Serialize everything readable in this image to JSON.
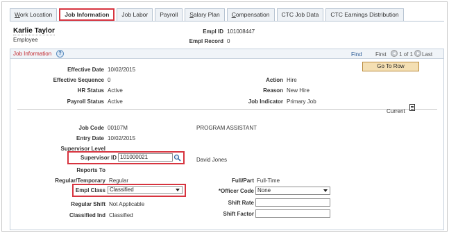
{
  "tabs": [
    {
      "label": "Work Location",
      "ul": "W",
      "rest": "ork Location",
      "active": false
    },
    {
      "label": "Job Information",
      "ul": "",
      "rest": "Job Information",
      "active": true
    },
    {
      "label": "Job Labor",
      "ul": "",
      "rest": "Job Labor",
      "active": false
    },
    {
      "label": "Payroll",
      "ul": "",
      "rest": "Payroll",
      "active": false
    },
    {
      "label": "Salary Plan",
      "ul": "S",
      "rest": "alary Plan",
      "active": false
    },
    {
      "label": "Compensation",
      "ul": "C",
      "rest": "ompensation",
      "active": false
    },
    {
      "label": "CTC Job Data",
      "ul": "",
      "rest": "CTC Job Data",
      "active": false
    },
    {
      "label": "CTC Earnings Distribution",
      "ul": "",
      "rest": "CTC Earnings Distribution",
      "active": false
    }
  ],
  "header": {
    "name": "Karlie Taylor",
    "role": "Employee",
    "empl_id_label": "Empl ID",
    "empl_id": "101008447",
    "empl_record_label": "Empl Record",
    "empl_record": "0"
  },
  "section": {
    "title": "Job Information",
    "help_icon": "?",
    "find": "Find",
    "first": "First",
    "count": "1 of 1",
    "last": "Last",
    "goto_row": "Go To Row",
    "current": "Current"
  },
  "fields": {
    "effective_date": {
      "label": "Effective Date",
      "value": "10/02/2015"
    },
    "effective_sequence": {
      "label": "Effective Sequence",
      "value": "0"
    },
    "hr_status": {
      "label": "HR Status",
      "value": "Active"
    },
    "payroll_status": {
      "label": "Payroll Status",
      "value": "Active"
    },
    "action": {
      "label": "Action",
      "value": "Hire"
    },
    "reason": {
      "label": "Reason",
      "value": "New Hire"
    },
    "job_indicator": {
      "label": "Job Indicator",
      "value": "Primary Job"
    },
    "job_code": {
      "label": "Job Code",
      "value": "00107M",
      "desc": "PROGRAM ASSISTANT"
    },
    "entry_date": {
      "label": "Entry Date",
      "value": "10/02/2015"
    },
    "supervisor_level": {
      "label": "Supervisor Level"
    },
    "supervisor_id": {
      "label": "Supervisor ID",
      "value": "101000021",
      "desc": "David Jones"
    },
    "reports_to": {
      "label": "Reports To"
    },
    "regular_temporary": {
      "label": "Regular/Temporary",
      "value": "Regular"
    },
    "full_part": {
      "label": "Full/Part",
      "value": "Full-Time"
    },
    "empl_class": {
      "label": "Empl Class",
      "value": "Classified"
    },
    "officer_code": {
      "label": "*Officer Code",
      "value": "None"
    },
    "regular_shift": {
      "label": "Regular Shift",
      "value": "Not Applicable"
    },
    "shift_rate": {
      "label": "Shift Rate",
      "value": ""
    },
    "classified_ind": {
      "label": "Classified Ind",
      "value": "Classified"
    },
    "shift_factor": {
      "label": "Shift Factor",
      "value": ""
    }
  },
  "colors": {
    "highlight": "#d7343f",
    "link": "#2a5b96",
    "section_title": "#c2272d",
    "button": "#f4dfb3"
  }
}
